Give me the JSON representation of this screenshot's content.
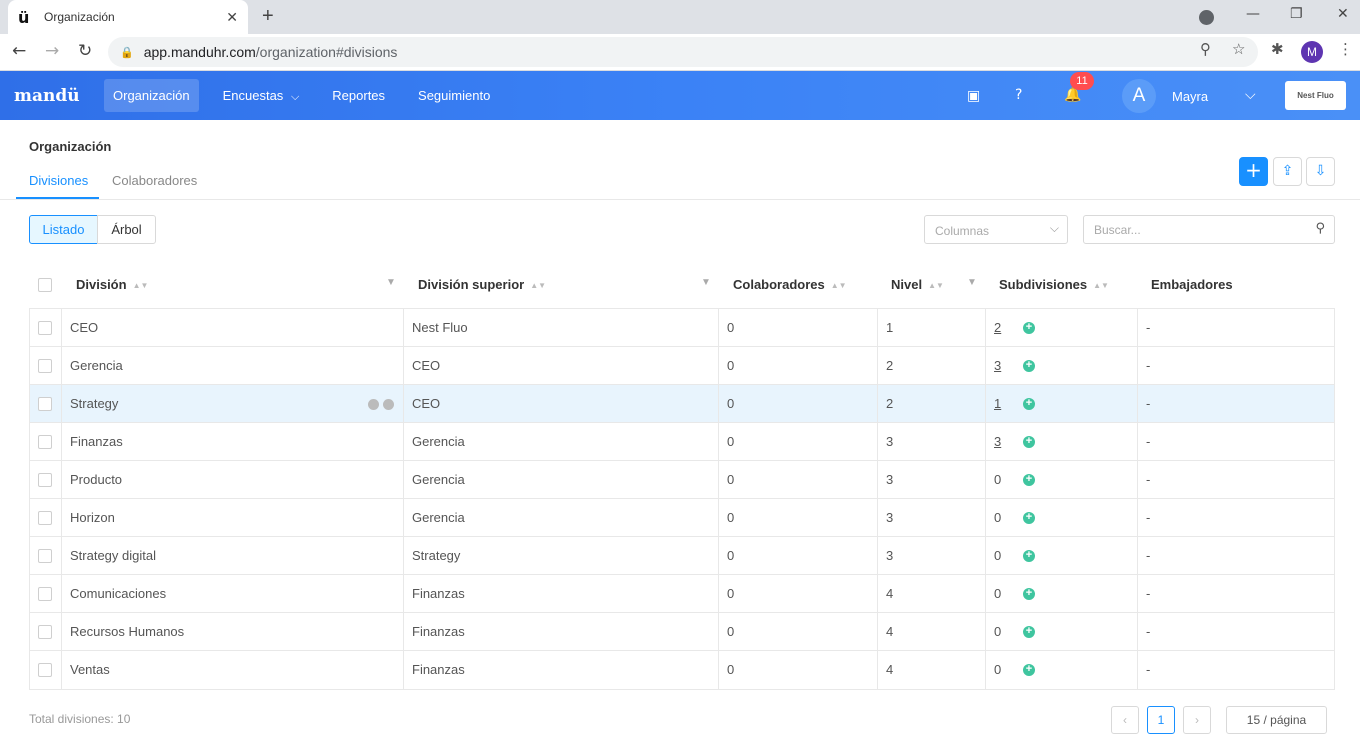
{
  "browser": {
    "tab_title": "Organización",
    "url_host": "app.manduhr.com",
    "url_path": "/organization#divisions",
    "profile_initial": "M"
  },
  "app": {
    "brand": "mandü",
    "nav": [
      {
        "label": "Organización"
      },
      {
        "label": "Encuestas"
      },
      {
        "label": "Reportes"
      },
      {
        "label": "Seguimiento"
      }
    ],
    "notifications": "11",
    "user_initial": "A",
    "user_name": "Mayra",
    "company": "Nest Fluo"
  },
  "page": {
    "title": "Organización",
    "tabs": [
      {
        "label": "Divisiones"
      },
      {
        "label": "Colaboradores"
      }
    ],
    "view_toggle": [
      {
        "label": "Listado"
      },
      {
        "label": "Árbol"
      }
    ],
    "columns_placeholder": "Columnas",
    "search_placeholder": "Buscar..."
  },
  "table": {
    "headers": {
      "division": "División",
      "parent": "División superior",
      "collaborators": "Colaboradores",
      "level": "Nivel",
      "subdivisions": "Subdivisiones",
      "ambassadors": "Embajadores"
    },
    "rows": [
      {
        "division": "CEO",
        "parent": "Nest Fluo",
        "collaborators": "0",
        "level": "1",
        "subdivisions": "2",
        "ambassadors": "-"
      },
      {
        "division": "Gerencia",
        "parent": "CEO",
        "collaborators": "0",
        "level": "2",
        "subdivisions": "3",
        "ambassadors": "-"
      },
      {
        "division": "Strategy",
        "parent": "CEO",
        "collaborators": "0",
        "level": "2",
        "subdivisions": "1",
        "ambassadors": "-"
      },
      {
        "division": "Finanzas",
        "parent": "Gerencia",
        "collaborators": "0",
        "level": "3",
        "subdivisions": "3",
        "ambassadors": "-"
      },
      {
        "division": "Producto",
        "parent": "Gerencia",
        "collaborators": "0",
        "level": "3",
        "subdivisions": "0",
        "ambassadors": "-"
      },
      {
        "division": "Horizon",
        "parent": "Gerencia",
        "collaborators": "0",
        "level": "3",
        "subdivisions": "0",
        "ambassadors": "-"
      },
      {
        "division": "Strategy digital",
        "parent": "Strategy",
        "collaborators": "0",
        "level": "3",
        "subdivisions": "0",
        "ambassadors": "-"
      },
      {
        "division": "Comunicaciones",
        "parent": "Finanzas",
        "collaborators": "0",
        "level": "4",
        "subdivisions": "0",
        "ambassadors": "-"
      },
      {
        "division": "Recursos Humanos",
        "parent": "Finanzas",
        "collaborators": "0",
        "level": "4",
        "subdivisions": "0",
        "ambassadors": "-"
      },
      {
        "division": "Ventas",
        "parent": "Finanzas",
        "collaborators": "0",
        "level": "4",
        "subdivisions": "0",
        "ambassadors": "-"
      }
    ]
  },
  "footer": {
    "total": "Total divisiones: 10",
    "current_page": "1",
    "page_size": "15 / página"
  }
}
